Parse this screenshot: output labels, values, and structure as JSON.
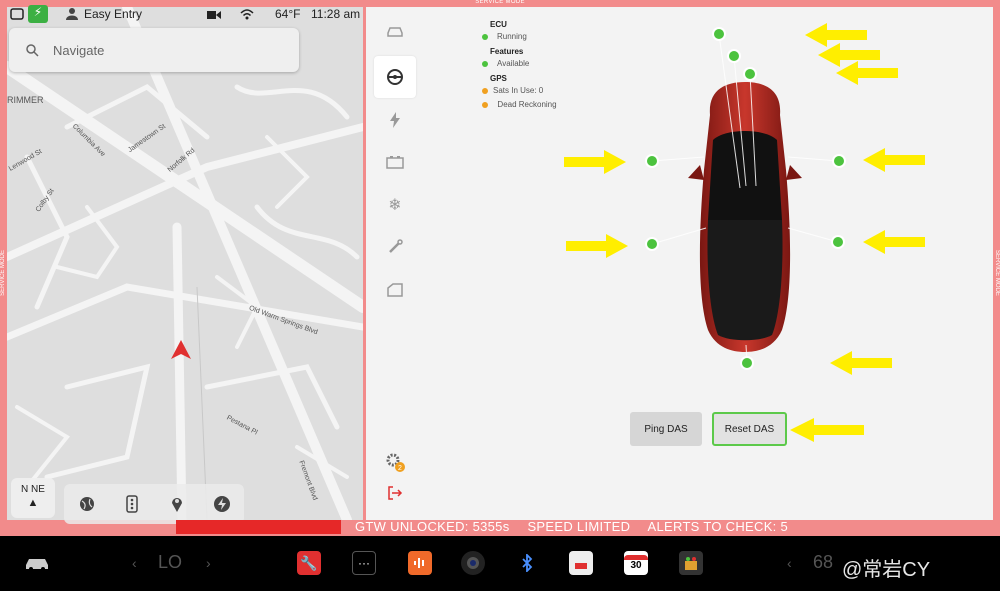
{
  "service_mode_label": "SERVICE MODE",
  "status_bar": {
    "profile": "Easy Entry",
    "temperature": "64°F",
    "time": "11:28 am"
  },
  "navigation": {
    "placeholder": "Navigate"
  },
  "map": {
    "labels": [
      "RIMMER",
      "Columbia Ave",
      "Jamestown St",
      "Norfolk Rd",
      "Colby St",
      "Old Warm Springs Blvd",
      "Fremont Blvd",
      "Pestana Pl",
      "Lenwood St"
    ]
  },
  "compass": {
    "heading": "N NE"
  },
  "das_status": {
    "groups": [
      {
        "title": "ECU",
        "items": [
          {
            "text": "Running",
            "color": "#4cc33e"
          }
        ]
      },
      {
        "title": "Features",
        "items": [
          {
            "text": "Available",
            "color": "#4cc33e"
          }
        ]
      },
      {
        "title": "GPS",
        "items": [
          {
            "text": "Sats In Use: 0",
            "color": "#f0a020"
          },
          {
            "text": "Dead Reckoning",
            "color": "#f0a020"
          }
        ]
      }
    ]
  },
  "buttons": {
    "ping_das": "Ping DAS",
    "reset_das": "Reset DAS"
  },
  "alert_bar": {
    "gtw": "GTW UNLOCKED: 5355s",
    "speed": "SPEED LIMITED",
    "alerts": "ALERTS TO CHECK: 5"
  },
  "taskbar": {
    "climate_left": "LO",
    "climate_right": "68",
    "calendar_day": "30",
    "watermark": "@常岩CY"
  },
  "colors": {
    "service_frame": "#f28b8b",
    "alert_red": "#e62828",
    "sensor_green": "#4cc33e",
    "arrow_yellow": "#ffee00",
    "car_red": "#b22a22"
  }
}
